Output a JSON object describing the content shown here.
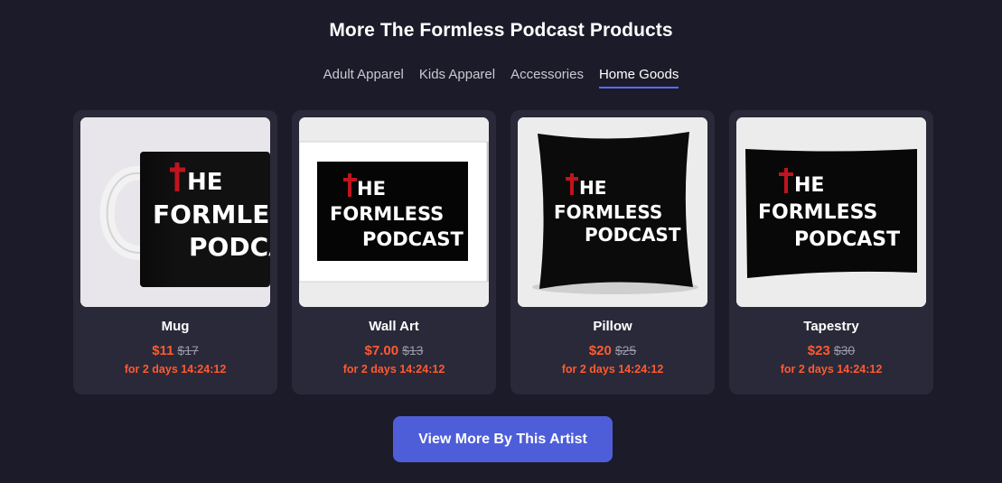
{
  "section": {
    "title": "More The Formless Podcast Products"
  },
  "tabs": [
    {
      "label": "Adult Apparel",
      "active": false
    },
    {
      "label": "Kids Apparel",
      "active": false
    },
    {
      "label": "Accessories",
      "active": false
    },
    {
      "label": "Home Goods",
      "active": true
    }
  ],
  "products": [
    {
      "name": "Mug",
      "sale_price": "$11",
      "original_price": "$17",
      "timer": "for 2 days 14:24:12"
    },
    {
      "name": "Wall Art",
      "sale_price": "$7.00",
      "original_price": "$13",
      "timer": "for 2 days 14:24:12"
    },
    {
      "name": "Pillow",
      "sale_price": "$20",
      "original_price": "$25",
      "timer": "for 2 days 14:24:12"
    },
    {
      "name": "Tapestry",
      "sale_price": "$23",
      "original_price": "$30",
      "timer": "for 2 days 14:24:12"
    }
  ],
  "logo": {
    "line1": "HE",
    "line2": "FORMLESS",
    "line3": "PODCAST",
    "accent_color": "#c0141e"
  },
  "cta": {
    "label": "View More By This Artist"
  },
  "colors": {
    "background": "#1c1b29",
    "card": "#292939",
    "sale": "#ff5a30",
    "button": "#4e5ed9",
    "tab_underline": "#5a6bff"
  }
}
